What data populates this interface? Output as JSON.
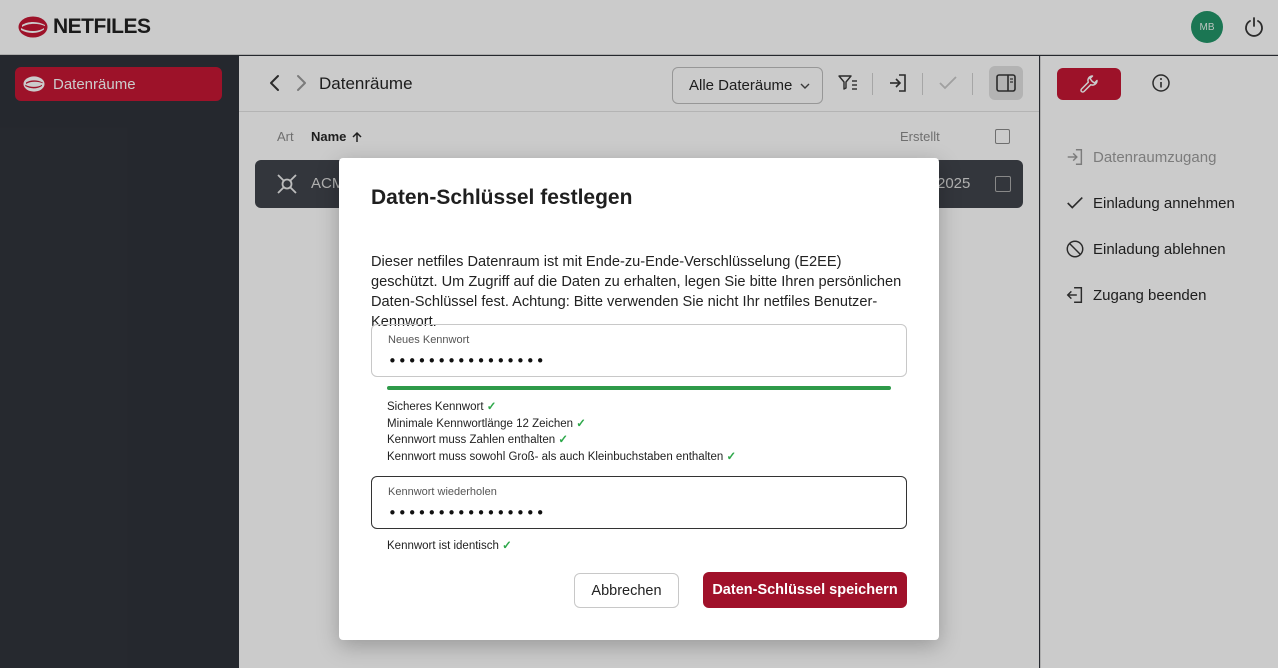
{
  "app": {
    "logo_text": "NETFILES"
  },
  "header": {
    "avatar_initials": "MB"
  },
  "sidebar": {
    "items": [
      {
        "label": "Datenräume",
        "icon": "netfiles-logo-icon",
        "active": true
      }
    ]
  },
  "toolbar": {
    "breadcrumb": "Datenräume",
    "filter_select_value": "Alle Dateräume",
    "icons": [
      "back-arrow-icon",
      "forward-arrow-icon",
      "filter-sort-icon",
      "enter-icon",
      "check-icon",
      "panel-toggle-icon"
    ]
  },
  "table": {
    "columns": {
      "art": "Art",
      "name": "Name",
      "created": "Erstellt"
    },
    "rows": [
      {
        "name": "ACM",
        "created": "2025"
      }
    ]
  },
  "right_panel": {
    "actions": [
      {
        "label": "Datenraumzugang",
        "icon": "enter-icon",
        "disabled": true
      },
      {
        "label": "Einladung annehmen",
        "icon": "check-icon",
        "disabled": false
      },
      {
        "label": "Einladung ablehnen",
        "icon": "block-icon",
        "disabled": false
      },
      {
        "label": "Zugang beenden",
        "icon": "exit-icon",
        "disabled": false
      }
    ]
  },
  "dialog": {
    "title": "Daten-Schlüssel festlegen",
    "description": "Dieser netfiles Datenraum ist mit Ende-zu-Ende-Verschlüsselung (E2EE) geschützt. Um Zugriff auf die Daten zu erhalten, legen Sie bitte Ihren persönlichen Daten-Schlüssel fest. Achtung: Bitte verwenden Sie nicht Ihr netfiles Benutzer-Kennwort.",
    "new_password": {
      "label": "Neues Kennwort",
      "value": "••••••••••••••••"
    },
    "strength": 1.0,
    "rules": [
      "Sicheres Kennwort",
      "Minimale Kennwortlänge 12 Zeichen",
      "Kennwort muss Zahlen enthalten",
      "Kennwort muss sowohl Groß- als auch Kleinbuchstaben enthalten"
    ],
    "check_mark": "✓",
    "repeat_password": {
      "label": "Kennwort wiederholen",
      "value": "••••••••••••••••"
    },
    "identical_text": "Kennwort ist identisch",
    "cancel_label": "Abbrechen",
    "save_label": "Daten-Schlüssel speichern"
  },
  "colors": {
    "brand": "#c41230",
    "success": "#2ea84b",
    "sidebar_bg": "#2b2f36"
  }
}
